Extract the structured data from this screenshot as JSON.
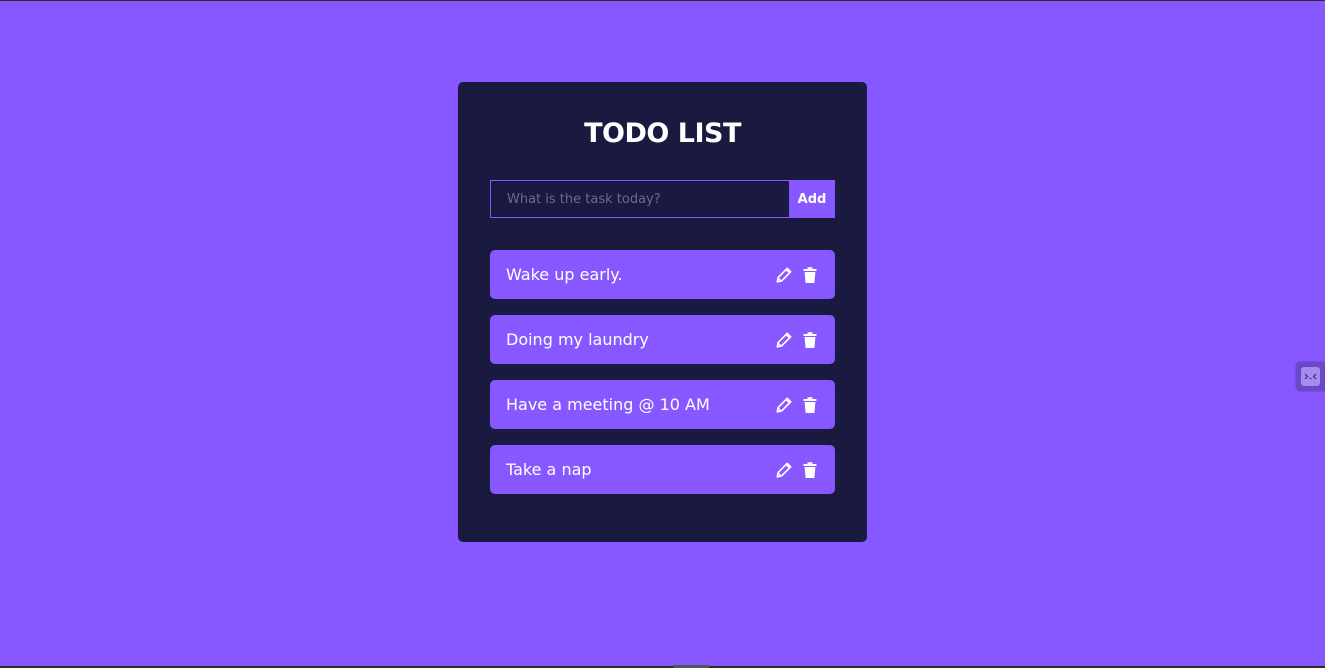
{
  "app": {
    "title": "TODO LIST"
  },
  "form": {
    "placeholder": "What is the task today?",
    "value": "",
    "add_label": "Add"
  },
  "todos": [
    {
      "text": "Wake up early."
    },
    {
      "text": "Doing my laundry"
    },
    {
      "text": "Have a meeting @ 10 AM"
    },
    {
      "text": "Take a nap"
    }
  ],
  "icons": {
    "edit": "pencil-icon",
    "delete": "trash-icon",
    "extension": "extension-icon"
  },
  "colors": {
    "background": "#8758ff",
    "card": "#1a1a40",
    "accent": "#8758ff",
    "text": "#ffffff"
  }
}
